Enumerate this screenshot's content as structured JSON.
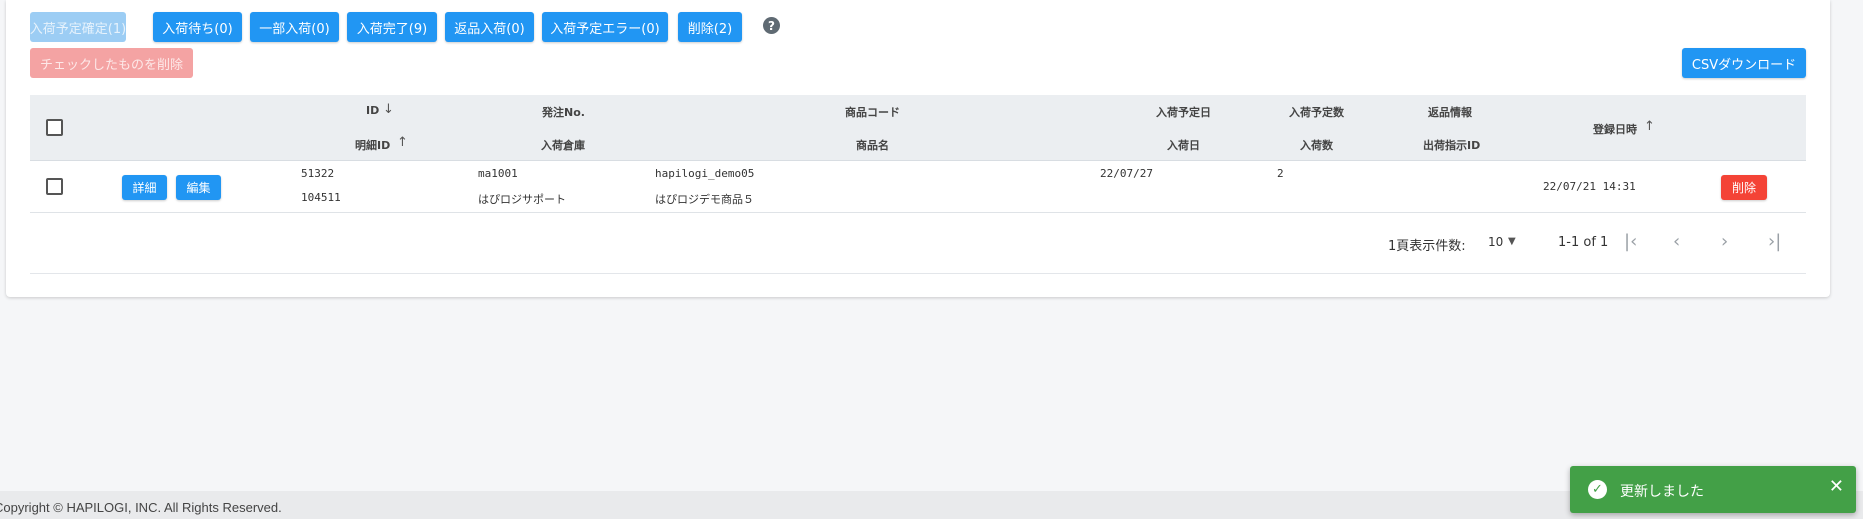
{
  "status_tabs": [
    {
      "label": "入荷予定確定(1)"
    },
    {
      "label": "入荷待ち(0)"
    },
    {
      "label": "一部入荷(0)"
    },
    {
      "label": "入荷完了(9)"
    },
    {
      "label": "返品入荷(0)"
    },
    {
      "label": "入荷予定エラー(0)"
    },
    {
      "label": "削除(2)"
    }
  ],
  "help_glyph": "?",
  "delete_checked_label": "チェックしたものを削除",
  "csv_download_label": "CSVダウンロード",
  "table": {
    "headers": {
      "id": "ID",
      "detail_id": "明細ID",
      "order_no": "発注No.",
      "warehouse": "入荷倉庫",
      "product_code": "商品コード",
      "product_name": "商品名",
      "scheduled_date": "入荷予定日",
      "arrival_date": "入荷日",
      "scheduled_qty": "入荷予定数",
      "arrival_qty": "入荷数",
      "return_info": "返品情報",
      "shipping_id": "出荷指示ID",
      "registered_at": "登録日時"
    },
    "sort_arrows": {
      "id": "↓",
      "detail_id": "↑",
      "registered_at": "↑"
    },
    "rows": [
      {
        "detail_button": "詳細",
        "edit_button": "編集",
        "id": "51322",
        "detail_id": "104511",
        "order_no": "ma1001",
        "warehouse": "はぴロジサポート",
        "product_code": "hapilogi_demo05",
        "product_name": "はぴロジデモ商品５",
        "scheduled_date": "22/07/27",
        "scheduled_qty": "2",
        "registered_at": "22/07/21 14:31",
        "delete_button": "削除"
      }
    ]
  },
  "pagination": {
    "per_page_label": "1頁表示件数:",
    "per_page_value": "10",
    "range": "1-1 of 1"
  },
  "footer": {
    "copyright": "Copyright © HAPILOGI, INC. All Rights Reserved."
  },
  "toast": {
    "message": "更新しました"
  }
}
